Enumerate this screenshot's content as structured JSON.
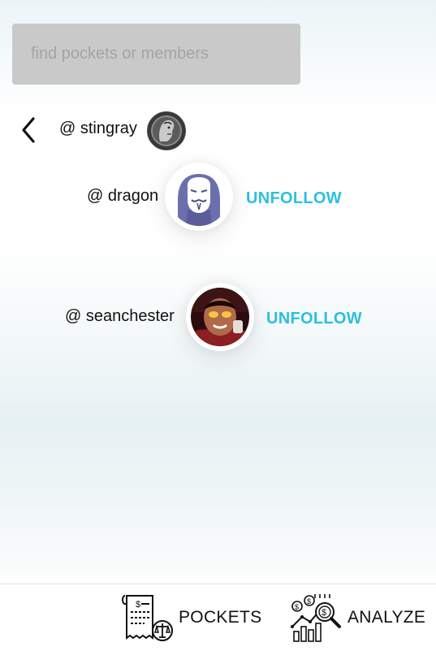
{
  "search": {
    "placeholder": "find pockets or members"
  },
  "header": {
    "back_icon": "chevron-left-icon",
    "owner_handle": "@ stingray",
    "owner_avatar_icon": "coin-avatar"
  },
  "members": [
    {
      "handle": "@ dragon",
      "action": "UNFOLLOW",
      "avatar_icon": "masked-hood-avatar"
    },
    {
      "handle": "@ seanchester",
      "action": "UNFOLLOW",
      "avatar_icon": "photo-avatar"
    }
  ],
  "colors": {
    "accent": "#2bbfe0",
    "search_bg": "#c9c9c9",
    "placeholder": "#a4a4a4"
  },
  "bottom_nav": {
    "tabs": [
      {
        "label": "POCKETS",
        "icon": "receipt-scale-icon"
      },
      {
        "label": "ANALYZE",
        "icon": "chart-magnifier-icon"
      }
    ]
  }
}
